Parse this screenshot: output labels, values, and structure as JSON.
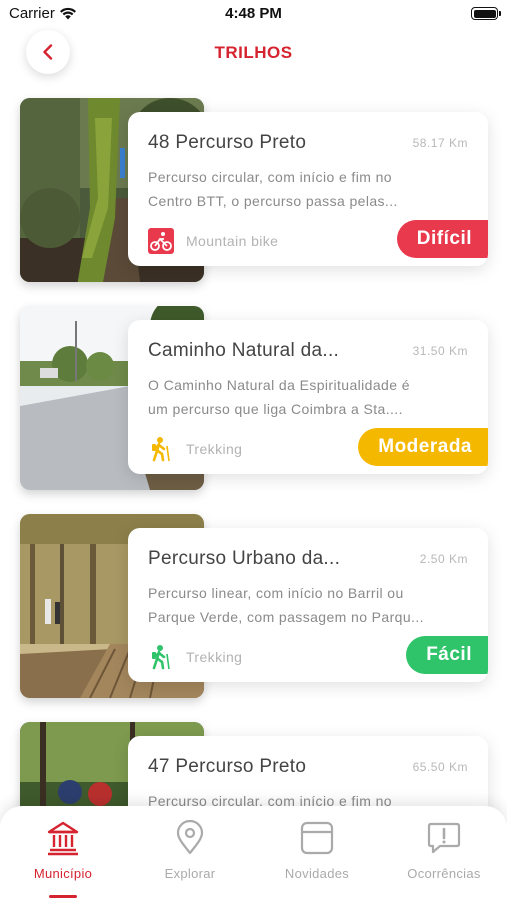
{
  "status_bar": {
    "carrier": "Carrier",
    "time": "4:48 PM"
  },
  "header": {
    "title": "TRILHOS",
    "back_icon": "chevron-left-icon"
  },
  "colors": {
    "accent": "#d5232f",
    "difficulty_hard": "#e8394d",
    "difficulty_moderate": "#f5b800",
    "difficulty_easy": "#2fc46a",
    "tab_inactive": "#aaaaaa"
  },
  "trails": [
    {
      "name": "48 Percurso Preto",
      "distance": "58.17 Km",
      "description_line1": "Percurso circular, com início e fim no",
      "description_line2": "Centro BTT, o percurso passa pelas...",
      "type": "Mountain bike",
      "type_icon": "mountain-bike-icon",
      "difficulty": "Difícil",
      "difficulty_color": "#e8394d"
    },
    {
      "name": "Caminho Natural da...",
      "distance": "31.50 Km",
      "description_line1": "O Caminho Natural da Espiritualidade é",
      "description_line2": "um percurso que liga Coimbra a Sta....",
      "type": "Trekking",
      "type_icon": "hiker-icon",
      "difficulty": "Moderada",
      "difficulty_color": "#f5b800"
    },
    {
      "name": "Percurso Urbano da...",
      "distance": "2.50 Km",
      "description_line1": "Percurso linear, com início no Barril ou",
      "description_line2": "Parque Verde, com passagem no Parqu...",
      "type": "Trekking",
      "type_icon": "hiker-icon",
      "difficulty": "Fácil",
      "difficulty_color": "#2fc46a"
    },
    {
      "name": "47 Percurso Preto",
      "distance": "65.50 Km",
      "description_line1": "Percurso circular, com início e fim no",
      "description_line2": ""
    }
  ],
  "tab_bar": {
    "tabs": [
      {
        "label": "Município",
        "icon": "town-hall-icon",
        "active": true
      },
      {
        "label": "Explorar",
        "icon": "map-pin-icon",
        "active": false
      },
      {
        "label": "Novidades",
        "icon": "news-card-icon",
        "active": false
      },
      {
        "label": "Ocorrências",
        "icon": "alert-message-icon",
        "active": false
      }
    ]
  }
}
